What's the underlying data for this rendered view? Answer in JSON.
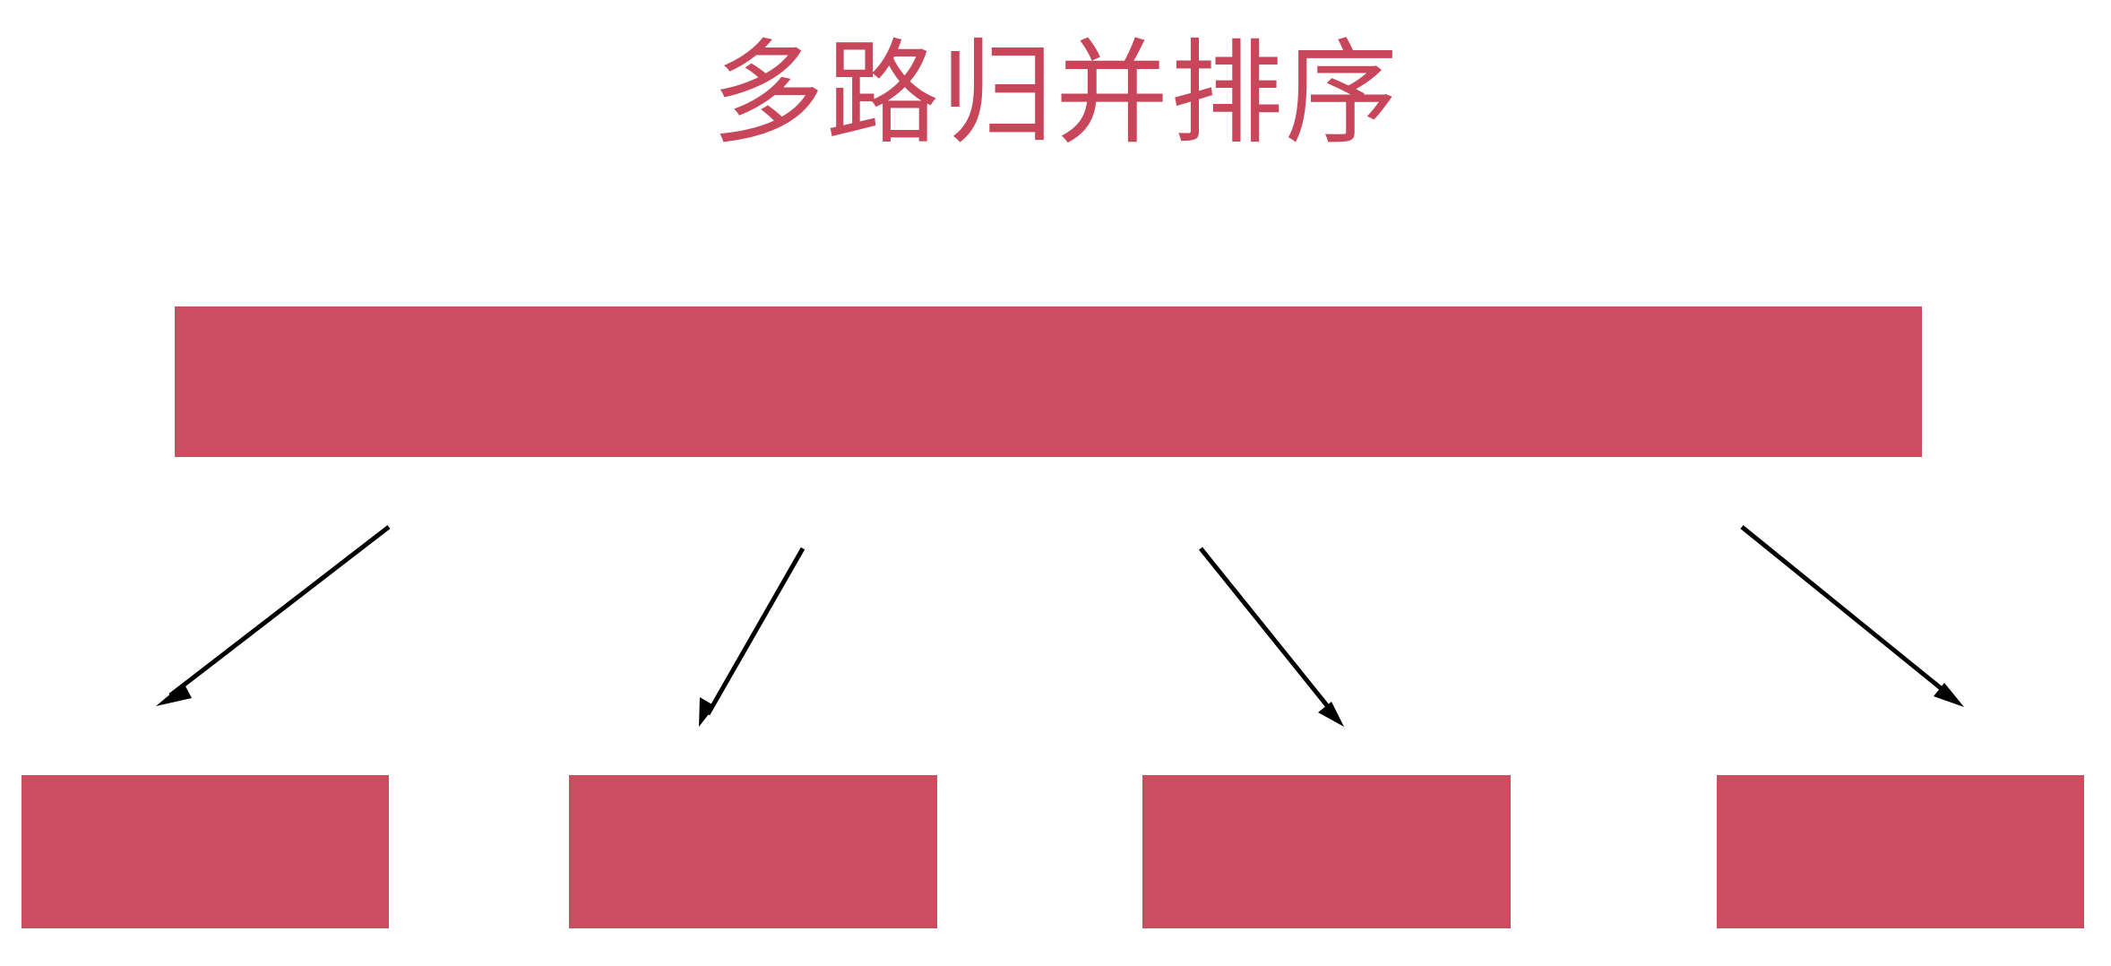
{
  "diagram": {
    "title": "多路归并排序",
    "colors": {
      "accent": "#cb4e60",
      "title": "#c8465a",
      "arrow": "#000000",
      "background": "#ffffff"
    },
    "nodes": {
      "parent": {
        "label": ""
      },
      "children": [
        {
          "label": ""
        },
        {
          "label": ""
        },
        {
          "label": ""
        },
        {
          "label": ""
        }
      ]
    }
  }
}
